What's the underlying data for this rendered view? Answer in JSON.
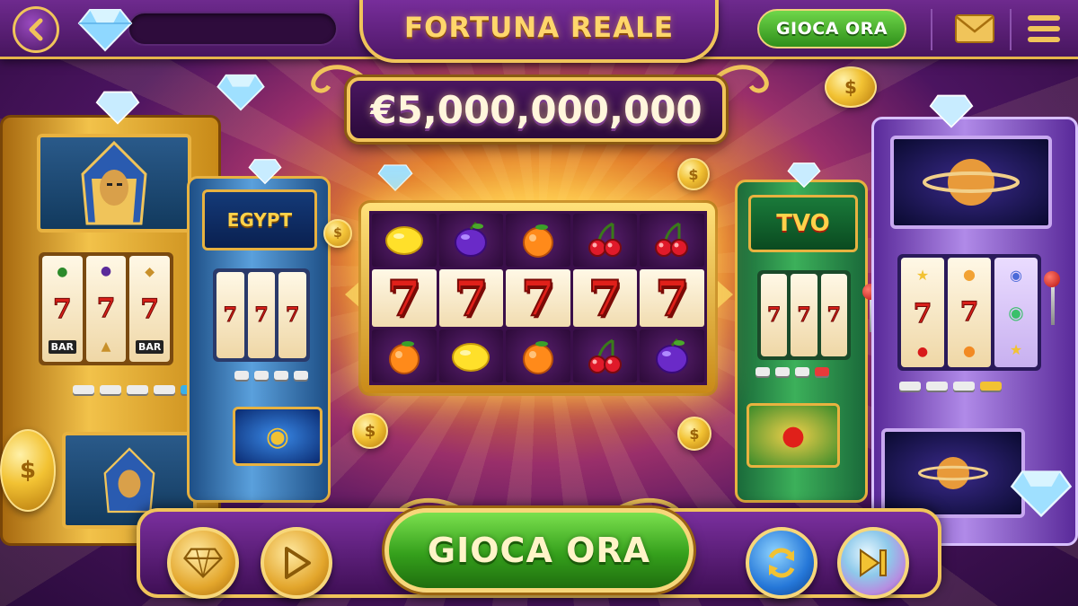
{
  "header": {
    "title": "FORTUNA REALE",
    "play_label": "GIOCA ORA",
    "progress": 0.0,
    "icons": [
      "back-arrow-icon",
      "diamond-icon",
      "mail-icon",
      "menu-icon"
    ]
  },
  "jackpot": {
    "amount": "€5,000,000,000"
  },
  "reels": {
    "top": [
      "lemon",
      "plum",
      "orange",
      "cherries",
      "cherries"
    ],
    "middle": [
      "7",
      "7",
      "7",
      "7",
      "7"
    ],
    "bottom": [
      "orange",
      "lemon",
      "orange",
      "cherries",
      "plum"
    ]
  },
  "machines": {
    "egypt_large": {
      "theme": "pharaoh",
      "reels_mid": [
        "7",
        "7",
        "7"
      ],
      "bar_label": "BAR"
    },
    "egypt_small": {
      "sign": "EGYPT",
      "reels_mid": [
        "7",
        "7",
        "7"
      ]
    },
    "fruit": {
      "sign": "TVO",
      "reels_mid": [
        "7",
        "7",
        "7"
      ]
    },
    "space": {
      "theme": "planet",
      "reels_mid": [
        "7",
        "7"
      ]
    }
  },
  "controls": {
    "play_label": "GIOCA ORA",
    "buttons": [
      "diamond-button",
      "play-button",
      "refresh-button",
      "skip-button"
    ]
  },
  "colors": {
    "gold": "#f0c45a",
    "purple": "#5a1a78",
    "green": "#35a01c",
    "seven_red": "#e0201a"
  }
}
